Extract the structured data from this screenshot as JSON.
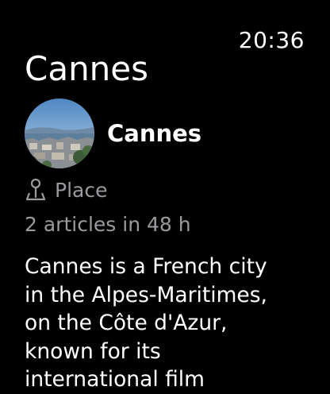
{
  "status_bar": {
    "time": "20:36"
  },
  "page": {
    "title": "Cannes"
  },
  "entity": {
    "name": "Cannes",
    "thumbnail_icon": "cannes-city-photo"
  },
  "type": {
    "icon": "map-pin-icon",
    "label": "Place"
  },
  "meta": {
    "articles": "2 articles in 48 h"
  },
  "description": {
    "lines": [
      "Cannes is a French city",
      "in the Alpes-Maritimes,",
      "on the Côte d'Azur,",
      "known for its",
      "international film"
    ]
  },
  "colors": {
    "background": "#000000",
    "primary_text": "#ffffff",
    "secondary_text": "#9a9a9f"
  }
}
